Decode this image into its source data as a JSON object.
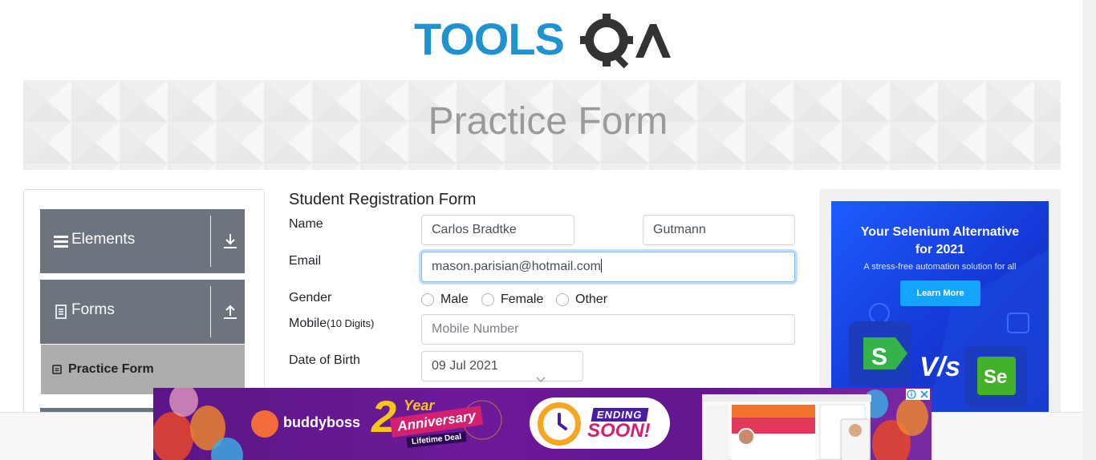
{
  "logo": {
    "text": "TOOLSQA",
    "primary_color": "#1f93d0",
    "secondary_color": "#333333"
  },
  "banner": {
    "title": "Practice Form"
  },
  "sidebar": {
    "groups": [
      {
        "label": "Elements",
        "icon": "menu-icon",
        "arrow": "download-arrow-icon"
      },
      {
        "label": "Forms",
        "icon": "document-icon",
        "arrow": "upload-arrow-icon"
      }
    ],
    "active_item": {
      "label": "Practice Form",
      "icon": "form-icon"
    }
  },
  "form": {
    "title": "Student Registration Form",
    "name_label": "Name",
    "first_name": "Carlos Bradtke",
    "last_name": "Gutmann",
    "email_label": "Email",
    "email_value": "mason.parisian@hotmail.com",
    "gender_label": "Gender",
    "gender_options": [
      "Male",
      "Female",
      "Other"
    ],
    "mobile_label": "Mobile",
    "mobile_hint": "(10 Digits)",
    "mobile_placeholder": "Mobile Number",
    "dob_label": "Date of Birth",
    "dob_value": "09 Jul 2021"
  },
  "right_ad": {
    "headline_line1": "Your Selenium Alternative",
    "headline_line2": "for 2021",
    "subtext": "A stress-free automation solution for all",
    "button": "Learn More",
    "vs": "V/s",
    "left_logo": "S",
    "right_logo": "Se"
  },
  "bottom_ad": {
    "brand": "buddyboss",
    "anniversary_number": "2",
    "anniversary_year": "Year",
    "anniversary_text": "Anniversary",
    "deal_text": "Lifetime Deal",
    "ending": "ENDING",
    "soon": "SOON!"
  },
  "colors": {
    "sidebar_group_bg": "#6c757d",
    "active_item_bg": "#adadad",
    "focus_border": "#80bdff",
    "ad_blue": "#1d4fe8",
    "bottom_ad_purple": "#6a1896"
  }
}
